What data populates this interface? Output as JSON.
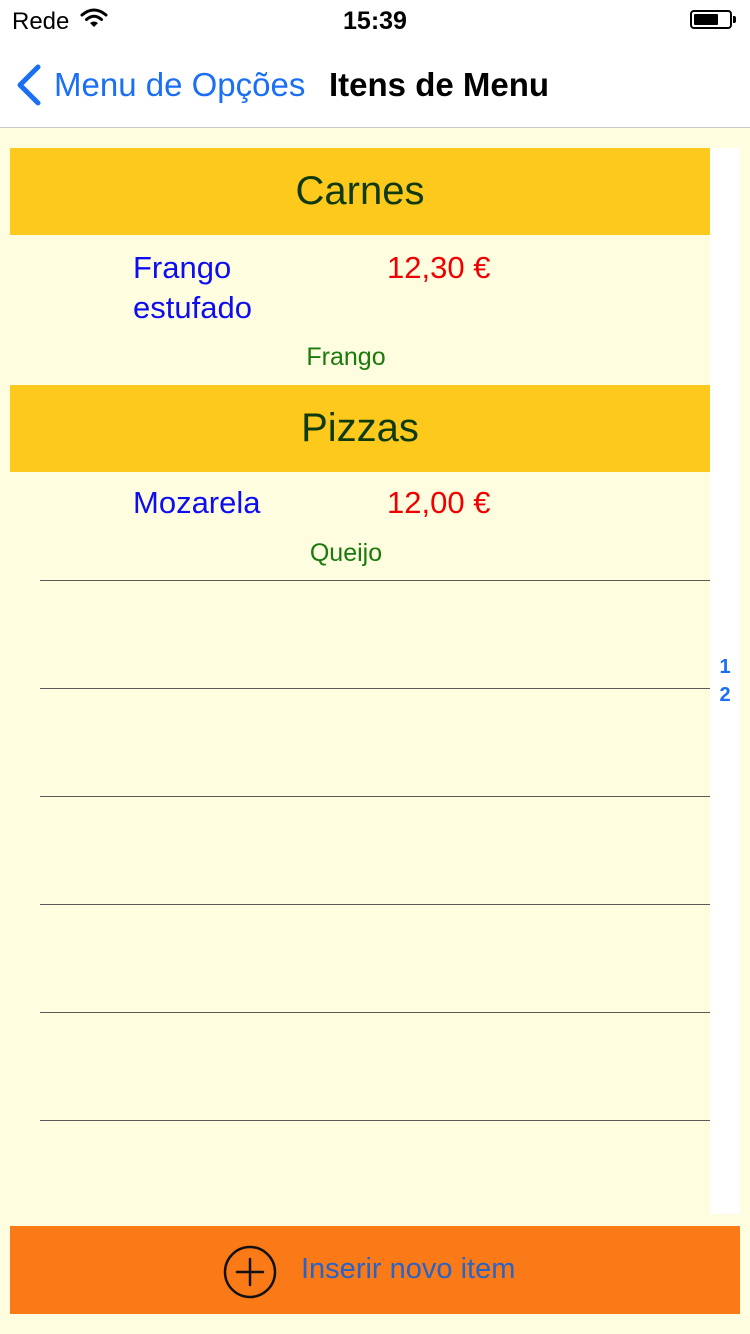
{
  "status_bar": {
    "carrier": "Rede",
    "time": "15:39",
    "wifi_icon": "wifi-icon",
    "battery_icon": "battery-icon"
  },
  "nav": {
    "back_label": "Menu de Opções",
    "title": "Itens de Menu",
    "back_icon": "chevron-left-icon"
  },
  "sections": [
    {
      "title": "Carnes",
      "items": [
        {
          "name": "Frango estufado",
          "price": "12,30 €",
          "category": "Frango"
        }
      ]
    },
    {
      "title": "Pizzas",
      "items": [
        {
          "name": "Mozarela",
          "price": "12,00 €",
          "category": "Queijo"
        }
      ]
    }
  ],
  "section_index": [
    "1",
    "2"
  ],
  "insert_button": {
    "label": "Inserir novo item",
    "icon": "plus-circle-icon"
  },
  "colors": {
    "background": "#fffde0",
    "section_header": "#fdc91c",
    "item_name": "#0d0df0",
    "item_price": "#ef0000",
    "item_category": "#1a7a0c",
    "insert_button": "#fb7a18",
    "accent_blue": "#1a6ff5"
  }
}
